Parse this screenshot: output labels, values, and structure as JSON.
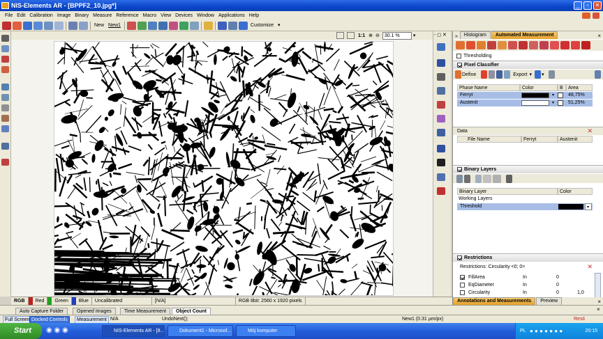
{
  "window": {
    "title": "NIS-Elements AR - [BPPF2_10.jpg*]"
  },
  "menu": [
    "File",
    "Edit",
    "Calibration",
    "Image",
    "Binary",
    "Measure",
    "Reference",
    "Macro",
    "View",
    "Devices",
    "Window",
    "Applications",
    "Help"
  ],
  "toolbar": {
    "new_label": "New",
    "new1_label": "New1",
    "customize_label": "Customize"
  },
  "viewer": {
    "zoom": "30.1 %",
    "fit_label": "1:1"
  },
  "panel": {
    "tabs": [
      "Histogram",
      "Automated Measurement"
    ],
    "thresholding_label": "Thresholding",
    "pixel_classifier_label": "Pixel Classifier",
    "define_label": "Define",
    "export_label": "Export",
    "phase_table": {
      "headers": [
        "Phase Name",
        "Color",
        "B",
        "Area"
      ],
      "rows": [
        {
          "name": "Ferryt",
          "area": "48,75%",
          "color": "#000000"
        },
        {
          "name": "Austenit",
          "area": "51,25%",
          "color": "#ffffff"
        }
      ]
    },
    "data_label": "Data",
    "data_headers": [
      "File Name",
      "Ferryt",
      "Austenit"
    ],
    "binary_layers_label": "Binary Layers",
    "binary_headers": [
      "Binary Layer",
      "Color"
    ],
    "working_layers_label": "Working Layers",
    "threshold_label": "Threshold",
    "restrictions_label": "Restrictions",
    "restrictions_value": "Restrictions:  Circularity  <0; 0>",
    "restriction_rows": [
      {
        "name": "FillArea",
        "op": "In",
        "val": "0",
        "checked": true
      },
      {
        "name": "EqDiameter",
        "op": "In",
        "val": "0",
        "checked": false
      },
      {
        "name": "Circularity",
        "op": "In",
        "val": "0",
        "extra": "1,0",
        "checked": false
      }
    ],
    "bottom_tabs": [
      "Annotations and Measurements",
      "Preview"
    ]
  },
  "image_status": {
    "rgb": "RGB",
    "red": "Red",
    "green": "Green",
    "blue": "Blue",
    "calibration": "Uncalibrated",
    "na": "[N/A]",
    "info": "RGB 8bit: 2560 x 1920 pixels"
  },
  "bottom_tabs": [
    "Auto Capture Folder",
    "Opened Images",
    "Time Measurement",
    "Object Count"
  ],
  "statusbar": {
    "fullscreen": "Full Screen",
    "docked": "Docked Controls",
    "measurement": "Measurement",
    "na": "N/A",
    "undo": "UndoNext();",
    "calib": "New1 (0.31 µm/px)",
    "resti": "Resti"
  },
  "taskbar": {
    "start": "Start",
    "tasks": [
      "NIS-Elements AR - [8...",
      "Dokument1 - Microsof...",
      "Mój komputer"
    ],
    "lang": "PL",
    "time": "20:15"
  }
}
